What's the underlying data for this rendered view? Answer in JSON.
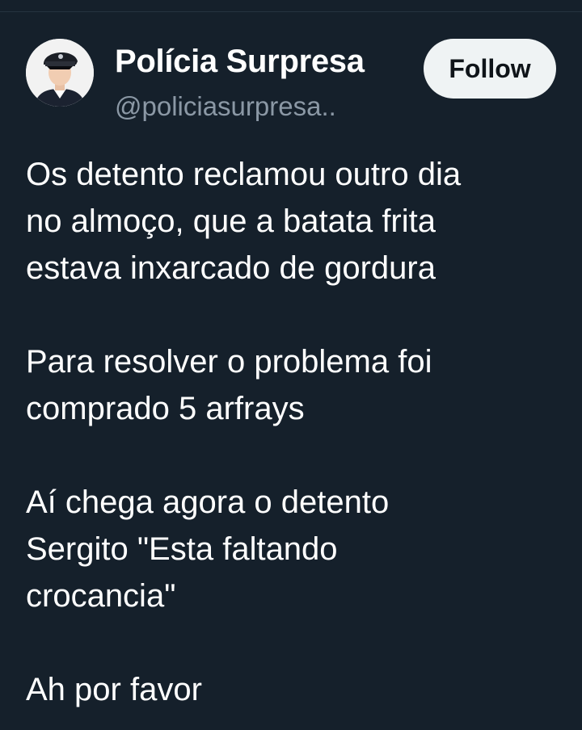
{
  "author": {
    "name": "Polícia Surpresa",
    "handle": "@policiasurpresa.."
  },
  "follow_button": {
    "label": "Follow"
  },
  "tweet": {
    "paragraphs": [
      [
        "Os detento reclamou outro dia",
        "no almoço, que a batata frita",
        "estava inxarcado de gordura"
      ],
      [
        "Para resolver o problema foi",
        "comprado 5 arfrays"
      ],
      [
        "Aí chega agora o detento",
        "Sergito \"Esta faltando",
        "crocancia\""
      ],
      [
        "Ah por favor"
      ]
    ]
  },
  "icons": {
    "avatar": "police-officer-avatar"
  },
  "colors": {
    "background": "#15202b",
    "text": "#ffffff",
    "secondary_text": "#8b98a5",
    "follow_button_bg": "#eff3f4",
    "follow_button_text": "#0f1419"
  }
}
